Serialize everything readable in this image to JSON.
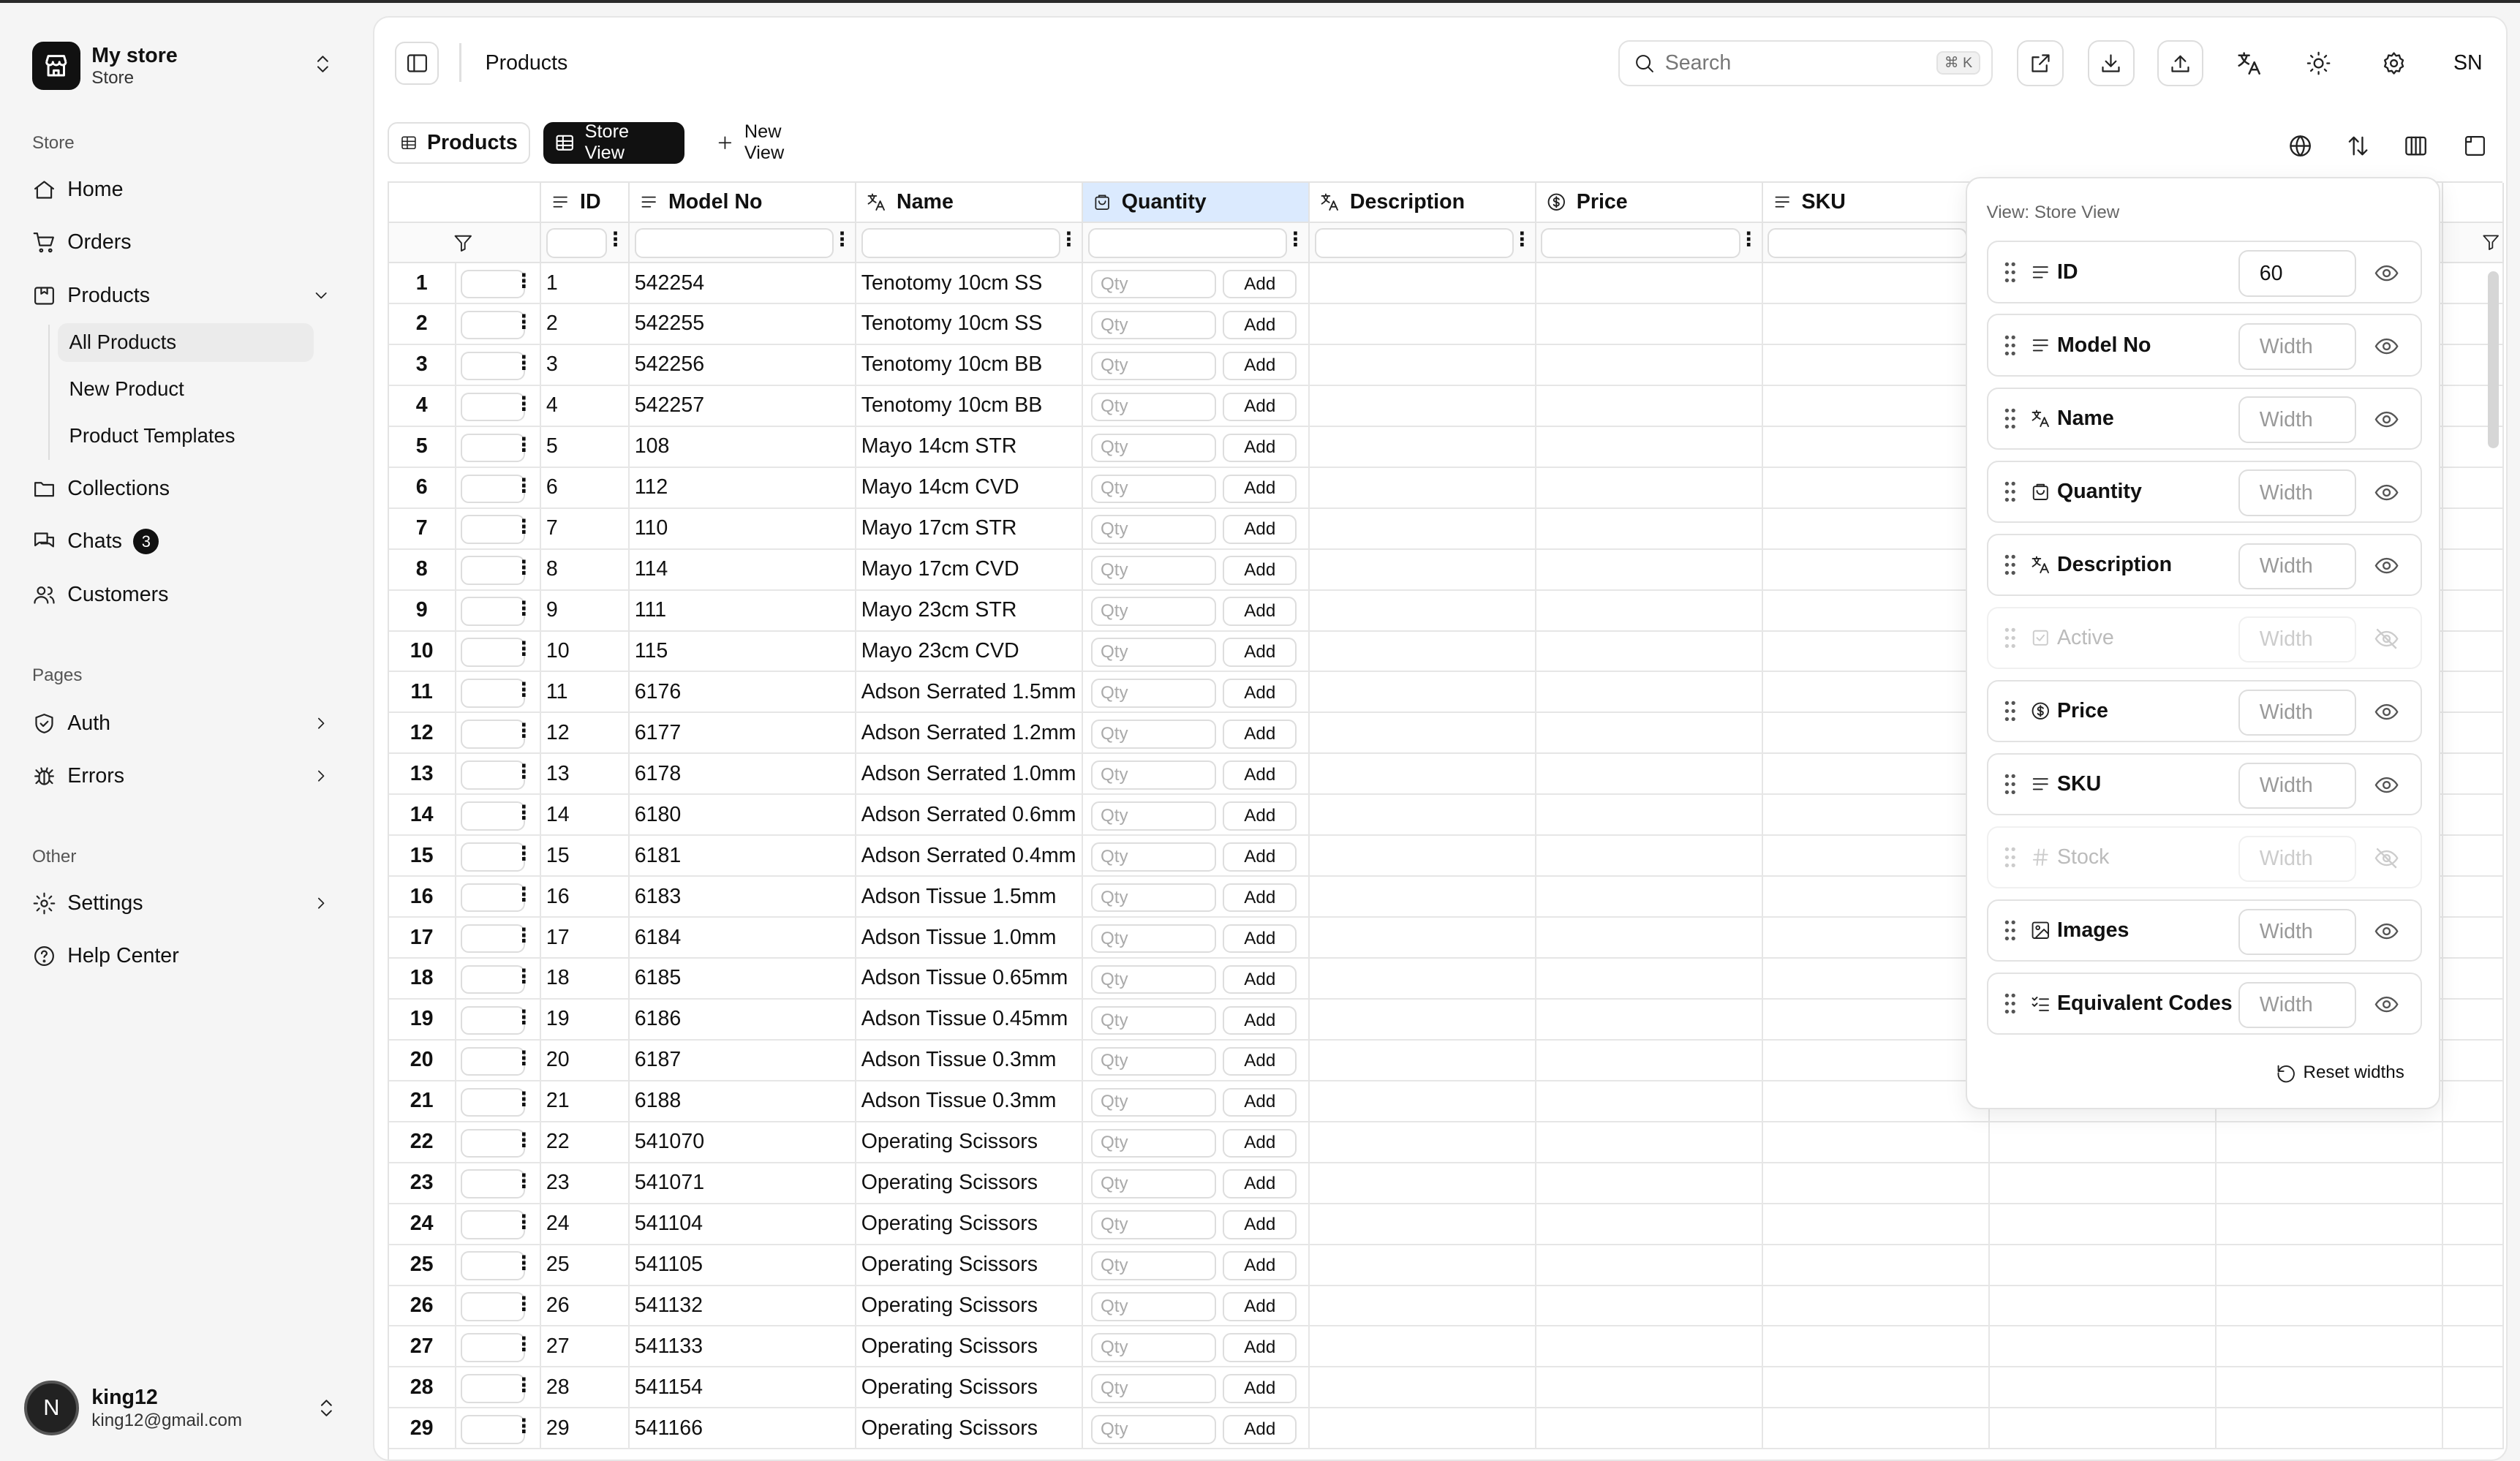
{
  "sidebar": {
    "store_name": "My store",
    "store_subtitle": "Store",
    "section_store": "Store",
    "section_pages": "Pages",
    "section_other": "Other",
    "home": "Home",
    "orders": "Orders",
    "products": "Products",
    "all_products": "All Products",
    "new_product": "New Product",
    "product_templates": "Product Templates",
    "collections": "Collections",
    "chats": "Chats",
    "chats_badge": "3",
    "customers": "Customers",
    "auth": "Auth",
    "errors": "Errors",
    "settings": "Settings",
    "help_center": "Help Center",
    "user_initial": "N",
    "user_name": "king12",
    "user_email": "king12@gmail.com"
  },
  "header": {
    "title": "Products",
    "search_placeholder": "Search",
    "search_shortcut": "⌘ K",
    "user_initials": "SN"
  },
  "tabs": {
    "products": "Products",
    "store_view": "Store View",
    "new_view": "New View"
  },
  "table": {
    "columns": {
      "id": "ID",
      "model_no": "Model No",
      "name": "Name",
      "quantity": "Quantity",
      "description": "Description",
      "price": "Price",
      "sku": "SKU"
    },
    "qty_placeholder": "Qty",
    "add_label": "Add",
    "rows": [
      {
        "n": "1",
        "id": "1",
        "model": "542254",
        "name": "Tenotomy 10cm SS"
      },
      {
        "n": "2",
        "id": "2",
        "model": "542255",
        "name": "Tenotomy 10cm SS"
      },
      {
        "n": "3",
        "id": "3",
        "model": "542256",
        "name": "Tenotomy 10cm BB"
      },
      {
        "n": "4",
        "id": "4",
        "model": "542257",
        "name": "Tenotomy 10cm BB"
      },
      {
        "n": "5",
        "id": "5",
        "model": "108",
        "name": "Mayo 14cm STR"
      },
      {
        "n": "6",
        "id": "6",
        "model": "112",
        "name": "Mayo 14cm CVD"
      },
      {
        "n": "7",
        "id": "7",
        "model": "110",
        "name": "Mayo 17cm STR"
      },
      {
        "n": "8",
        "id": "8",
        "model": "114",
        "name": "Mayo 17cm CVD"
      },
      {
        "n": "9",
        "id": "9",
        "model": "111",
        "name": "Mayo 23cm STR"
      },
      {
        "n": "10",
        "id": "10",
        "model": "115",
        "name": "Mayo 23cm CVD"
      },
      {
        "n": "11",
        "id": "11",
        "model": "6176",
        "name": "Adson Serrated 1.5mm"
      },
      {
        "n": "12",
        "id": "12",
        "model": "6177",
        "name": "Adson Serrated 1.2mm"
      },
      {
        "n": "13",
        "id": "13",
        "model": "6178",
        "name": "Adson Serrated 1.0mm"
      },
      {
        "n": "14",
        "id": "14",
        "model": "6180",
        "name": "Adson Serrated 0.6mm"
      },
      {
        "n": "15",
        "id": "15",
        "model": "6181",
        "name": "Adson Serrated 0.4mm"
      },
      {
        "n": "16",
        "id": "16",
        "model": "6183",
        "name": "Adson Tissue 1.5mm"
      },
      {
        "n": "17",
        "id": "17",
        "model": "6184",
        "name": "Adson Tissue 1.0mm"
      },
      {
        "n": "18",
        "id": "18",
        "model": "6185",
        "name": "Adson Tissue 0.65mm"
      },
      {
        "n": "19",
        "id": "19",
        "model": "6186",
        "name": "Adson Tissue 0.45mm"
      },
      {
        "n": "20",
        "id": "20",
        "model": "6187",
        "name": "Adson Tissue 0.3mm"
      },
      {
        "n": "21",
        "id": "21",
        "model": "6188",
        "name": "Adson Tissue 0.3mm"
      },
      {
        "n": "22",
        "id": "22",
        "model": "541070",
        "name": "Operating Scissors"
      },
      {
        "n": "23",
        "id": "23",
        "model": "541071",
        "name": "Operating Scissors"
      },
      {
        "n": "24",
        "id": "24",
        "model": "541104",
        "name": "Operating Scissors"
      },
      {
        "n": "25",
        "id": "25",
        "model": "541105",
        "name": "Operating Scissors"
      },
      {
        "n": "26",
        "id": "26",
        "model": "541132",
        "name": "Operating Scissors"
      },
      {
        "n": "27",
        "id": "27",
        "model": "541133",
        "name": "Operating Scissors"
      },
      {
        "n": "28",
        "id": "28",
        "model": "541154",
        "name": "Operating Scissors"
      },
      {
        "n": "29",
        "id": "29",
        "model": "541166",
        "name": "Operating Scissors"
      }
    ]
  },
  "view_settings": {
    "title": "View: Store View",
    "width_placeholder": "Width",
    "reset_label": "Reset widths",
    "columns": [
      {
        "label": "ID",
        "width": "60",
        "visible": true,
        "icon": "text-lines-icon"
      },
      {
        "label": "Model No",
        "width": "",
        "visible": true,
        "icon": "text-lines-icon"
      },
      {
        "label": "Name",
        "width": "",
        "visible": true,
        "icon": "translate-icon"
      },
      {
        "label": "Quantity",
        "width": "",
        "visible": true,
        "icon": "cart-icon"
      },
      {
        "label": "Description",
        "width": "",
        "visible": true,
        "icon": "translate-icon"
      },
      {
        "label": "Active",
        "width": "",
        "visible": false,
        "icon": "checkbox-icon"
      },
      {
        "label": "Price",
        "width": "",
        "visible": true,
        "icon": "dollar-circle-icon"
      },
      {
        "label": "SKU",
        "width": "",
        "visible": true,
        "icon": "text-lines-icon"
      },
      {
        "label": "Stock",
        "width": "",
        "visible": false,
        "icon": "hash-icon"
      },
      {
        "label": "Images",
        "width": "",
        "visible": true,
        "icon": "images-icon"
      },
      {
        "label": "Equivalent Codes",
        "width": "",
        "visible": true,
        "icon": "checklist-icon"
      }
    ]
  },
  "colors": {
    "accent_dark": "#111111",
    "header_highlight": "#dbeafe",
    "background": "#f5f5f5"
  }
}
